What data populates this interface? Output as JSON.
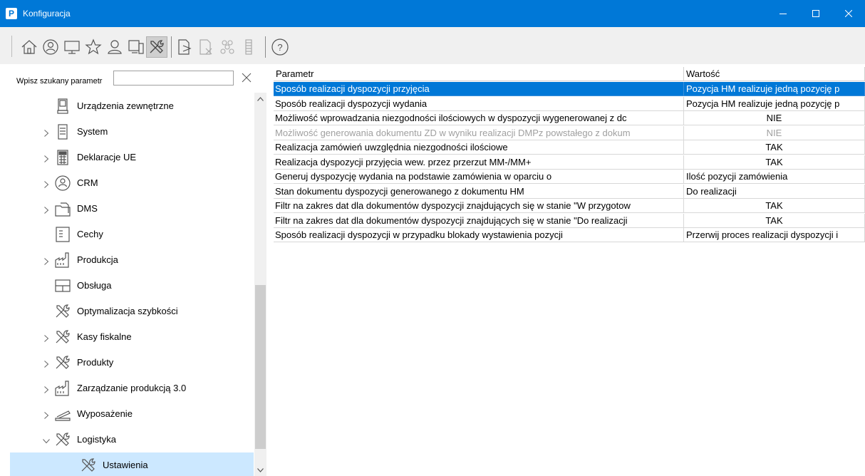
{
  "window": {
    "title": "Konfiguracja",
    "app_icon_letter": "P"
  },
  "toolbar": {
    "buttons": [
      {
        "icon": "home-icon"
      },
      {
        "icon": "contact-icon"
      },
      {
        "icon": "computer-icon"
      },
      {
        "icon": "star-icon"
      },
      {
        "icon": "user-icon"
      },
      {
        "icon": "devices-icon"
      },
      {
        "icon": "tools-icon",
        "active": true
      },
      {
        "icon": "document-arrow-icon"
      },
      {
        "icon": "document-x-icon"
      },
      {
        "icon": "group-icon"
      },
      {
        "icon": "list-icon"
      },
      {
        "icon": "help-icon"
      }
    ]
  },
  "search": {
    "label": "Wpisz szukany parametr",
    "value": "",
    "placeholder": ""
  },
  "tree": {
    "items": [
      {
        "label": "Urządzenia zewnętrzne",
        "icon": "device-icon",
        "expander": "none",
        "level": 1
      },
      {
        "label": "System",
        "icon": "server-icon",
        "expander": "collapsed",
        "level": 1
      },
      {
        "label": "Deklaracje UE",
        "icon": "calculator-icon",
        "expander": "collapsed",
        "level": 1
      },
      {
        "label": "CRM",
        "icon": "crm-icon",
        "expander": "collapsed",
        "level": 1
      },
      {
        "label": "DMS",
        "icon": "folder-doc-icon",
        "expander": "collapsed",
        "level": 1
      },
      {
        "label": "Cechy",
        "icon": "list-doc-icon",
        "expander": "none",
        "level": 1
      },
      {
        "label": "Produkcja",
        "icon": "factory-icon",
        "expander": "collapsed",
        "level": 1
      },
      {
        "label": "Obsługa",
        "icon": "window-icon",
        "expander": "none",
        "level": 1
      },
      {
        "label": "Optymalizacja szybkości",
        "icon": "tools-icon",
        "expander": "none",
        "level": 1
      },
      {
        "label": "Kasy fiskalne",
        "icon": "tools-icon",
        "expander": "collapsed",
        "level": 1
      },
      {
        "label": "Produkty",
        "icon": "tools-icon",
        "expander": "collapsed",
        "level": 1
      },
      {
        "label": "Zarządzanie produkcją 3.0",
        "icon": "factory-icon",
        "expander": "collapsed",
        "level": 1
      },
      {
        "label": "Wyposażenie",
        "icon": "stapler-icon",
        "expander": "collapsed",
        "level": 1
      },
      {
        "label": "Logistyka",
        "icon": "tools-icon",
        "expander": "expanded",
        "level": 1
      },
      {
        "label": "Ustawienia",
        "icon": "tools-icon",
        "expander": "none",
        "level": 2,
        "selected": true
      }
    ]
  },
  "grid": {
    "headers": [
      "Parametr",
      "Wartość"
    ],
    "rows": [
      {
        "param": "Sposób realizacji dyspozycji przyjęcia",
        "value": "Pozycja HM realizuje jedną pozycję p",
        "align": "left",
        "selected": true
      },
      {
        "param": "Sposób realizacji dyspozycji wydania",
        "value": "Pozycja HM realizuje jedną pozycję p",
        "align": "left"
      },
      {
        "param": "Możliwość wprowadzania niezgodności ilościowych w dyspozycji wygenerowanej z dc",
        "value": "NIE",
        "align": "center"
      },
      {
        "param": "Możliwość generowania dokumentu ZD w wyniku realizacji DMPz powstałego z dokum",
        "value": "NIE",
        "align": "center",
        "disabled": true
      },
      {
        "param": "Realizacja zamówień uwzględnia niezgodności ilościowe",
        "value": "TAK",
        "align": "center"
      },
      {
        "param": "Realizacja dyspozycji przyjęcia wew. przez przerzut MM-/MM+",
        "value": "TAK",
        "align": "center"
      },
      {
        "param": "Generuj dyspozycję wydania na podstawie zamówienia w oparciu o",
        "value": "Ilość pozycji zamówienia",
        "align": "left"
      },
      {
        "param": "Stan dokumentu dyspozycji generowanego z dokumentu HM",
        "value": "Do realizacji",
        "align": "left"
      },
      {
        "param": "Filtr na zakres dat dla dokumentów dyspozycji znajdujących się w stanie \"W przygotow",
        "value": "TAK",
        "align": "center"
      },
      {
        "param": "Filtr na zakres dat dla dokumentów dyspozycji znajdujących się w stanie \"Do realizacji",
        "value": "TAK",
        "align": "center"
      },
      {
        "param": "Sposób realizacji dyspozycji w przypadku blokady wystawienia pozycji",
        "value": "Przerwij proces realizacji dyspozycji i",
        "align": "left"
      }
    ]
  },
  "colors": {
    "titlebar": "#0078d7",
    "selection": "#0078d7",
    "tree_selection": "#cce8ff"
  }
}
